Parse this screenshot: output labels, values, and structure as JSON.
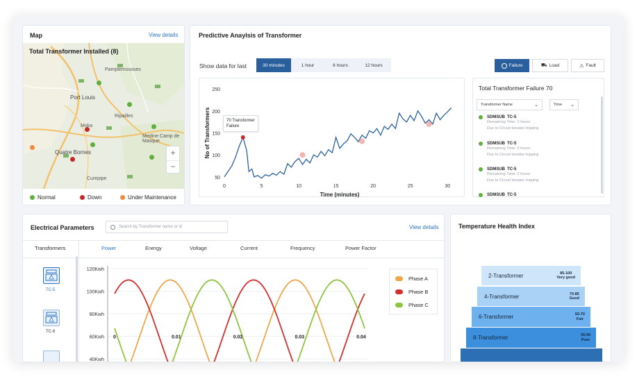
{
  "map": {
    "title": "Map",
    "view_details": "View details",
    "installed_label": "Total Transformer Installed (8)",
    "places": [
      "Pamplemousses",
      "Port Louis",
      "Ripailles",
      "Moka",
      "Quatre Bornes",
      "Medine Camp de Masque",
      "Curepipe"
    ],
    "legend": [
      "Normal",
      "Down",
      "Under Maintenance"
    ],
    "colors": {
      "normal": "#5fae3f",
      "down": "#c62828",
      "maintenance": "#ee8a3c"
    }
  },
  "predictive": {
    "title": "Predictive Anaylsis of Transformer",
    "show_data_label": "Show data for last",
    "ranges": [
      "30 minutes",
      "1 hour",
      "6 hours",
      "12 hours"
    ],
    "active_range": "30 minutes",
    "types": [
      "Failure",
      "Load",
      "Fault"
    ],
    "active_type": "Failure",
    "tooltip_line1": "70 Transformer",
    "tooltip_line2": "Failure"
  },
  "chart_data": [
    {
      "type": "line",
      "xlabel": "Time (minutes)",
      "ylabel": "No of Transformers",
      "xlim": [
        0,
        31
      ],
      "ylim": [
        45,
        255
      ],
      "xticks": [
        "0",
        "5",
        "10",
        "15",
        "20",
        "25",
        "30"
      ],
      "yticks": [
        "50",
        "100",
        "150",
        "200",
        "250"
      ],
      "series": [
        {
          "x": [
            0,
            1,
            1.5,
            2,
            2.5,
            3,
            3.3,
            3.7,
            4,
            4.5,
            5,
            5.5,
            6,
            6.5,
            7,
            7.5,
            8,
            8.5,
            9,
            9.5,
            10,
            10.5,
            11,
            11.5,
            12,
            12.5,
            13,
            13.5,
            14,
            14.5,
            15,
            15.5,
            16,
            16.5,
            17,
            17.5,
            18,
            18.5,
            19,
            19.5,
            20,
            20.5,
            21,
            21.5,
            22,
            22.5,
            23,
            23.5,
            24,
            24.5,
            25,
            25.5,
            26,
            26.5,
            27,
            27.5,
            28,
            28.5,
            29,
            29.5,
            30,
            30.5
          ],
          "y": [
            50,
            75,
            95,
            120,
            140,
            110,
            62,
            68,
            50,
            53,
            47,
            55,
            52,
            58,
            54,
            62,
            56,
            80,
            72,
            85,
            92,
            78,
            90,
            82,
            100,
            95,
            108,
            98,
            112,
            105,
            140,
            115,
            125,
            132,
            148,
            140,
            130,
            145,
            138,
            155,
            150,
            160,
            145,
            165,
            158,
            170,
            160,
            195,
            182,
            175,
            190,
            178,
            200,
            188,
            172,
            180,
            170,
            195,
            180,
            190,
            198,
            207
          ]
        }
      ],
      "highlights": [
        {
          "x": 2.5,
          "y": 140
        },
        {
          "x": 10.5,
          "y": 100
        },
        {
          "x": 18.5,
          "y": 131
        },
        {
          "x": 27.5,
          "y": 170
        }
      ]
    },
    {
      "type": "line",
      "yticks": [
        "120Kwh",
        "100Kwh",
        "80Kwh",
        "60Kwh",
        "40Kwh"
      ],
      "xticks": [
        "0",
        "0.01",
        "0.02",
        "0.03",
        "0.04"
      ],
      "ylim": [
        40,
        120
      ],
      "xlim": [
        0,
        0.04
      ],
      "series": [
        {
          "name": "Phase A",
          "color": "#f0a64a"
        },
        {
          "name": "Phase B",
          "color": "#d32f2f"
        },
        {
          "name": "Phase C",
          "color": "#8cc63f"
        }
      ]
    }
  ],
  "failures": {
    "title": "Total Transformer Failure 70",
    "name_dropdown": "Transformer Name",
    "time_dropdown": "Time",
    "items": [
      {
        "name": "SDMSUB",
        "code": "TC-5",
        "line1": "Remaining Time: 2 hours",
        "line2": "Due to Circuit breaker tripping"
      },
      {
        "name": "SDMSUB",
        "code": "TC-5",
        "line1": "Remaining Time: 2 hours",
        "line2": "Due to Circuit breaker tripping"
      },
      {
        "name": "SDMSUB",
        "code": "TC-5",
        "line1": "Remaining Time: 2 hours",
        "line2": "Due to Circuit breaker tripping"
      },
      {
        "name": "SDMSUB",
        "code": "TC-5",
        "line1": "",
        "line2": ""
      }
    ]
  },
  "electrical": {
    "title": "Electrical Parameters",
    "search_placeholder": "Search by Transformer name or id",
    "view_details": "View details",
    "transformers_label": "Transformers",
    "tabs": [
      "Power",
      "Energy",
      "Voltage",
      "Current",
      "Frequency",
      "Power Factor"
    ],
    "active_tab": "Power",
    "transformers": [
      "TC-5",
      "TC-6"
    ]
  },
  "temperature": {
    "title": "Temperature Health Index",
    "levels": [
      {
        "label": "2-Transformer",
        "range": "85-100",
        "status": "Very good"
      },
      {
        "label": "4-Transformer",
        "range": "70-85",
        "status": "Good"
      },
      {
        "label": "6-Transformer",
        "range": "50-70",
        "status": "Fair"
      },
      {
        "label": "8-Transformer",
        "range": "30-50",
        "status": "Poor"
      }
    ]
  }
}
